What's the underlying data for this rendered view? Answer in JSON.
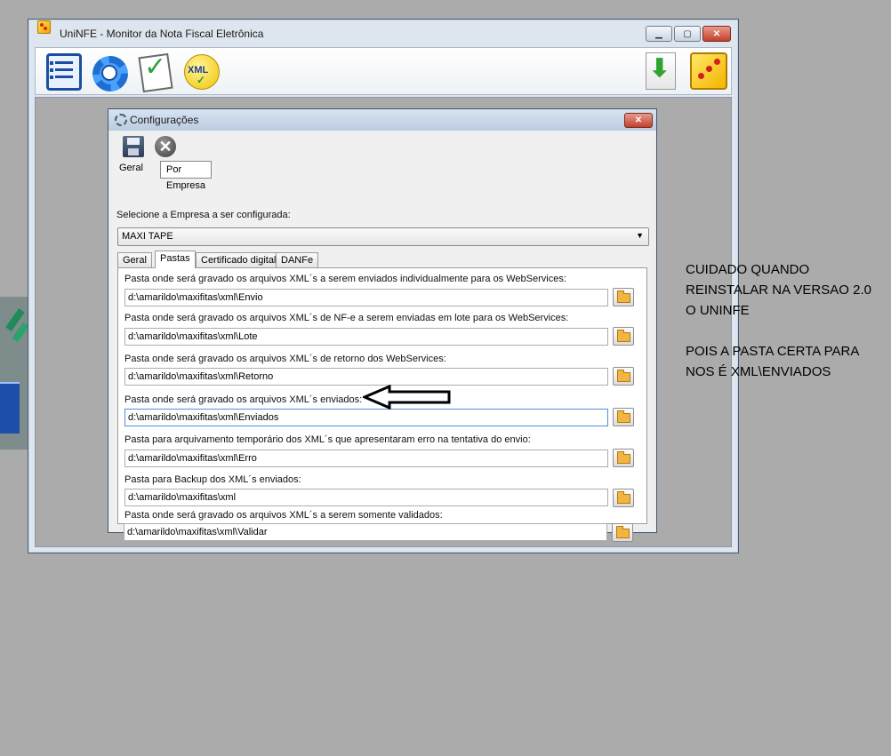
{
  "main_window": {
    "title": "UniNFE - Monitor da Nota Fiscal Eletrônica"
  },
  "icons": {
    "toolbar": [
      "forms-icon",
      "settings-gear-icon",
      "checklist-icon",
      "xml-icon",
      "download-icon",
      "app-logo-icon"
    ],
    "dialog": [
      "gear-icon",
      "save-icon",
      "cancel-icon",
      "folder-icon",
      "arrow-left-icon"
    ]
  },
  "config_dialog": {
    "title": "Configurações",
    "top_tabs": [
      "Geral",
      "Por Empresa"
    ],
    "company_label": "Selecione a Empresa a ser configurada:",
    "company_selected": "MAXI TAPE",
    "inner_tabs": [
      "Geral",
      "Pastas",
      "Certificado digital",
      "DANFe"
    ],
    "folders": [
      {
        "label": "Pasta onde será gravado os arquivos XML´s a serem enviados individualmente para os WebServices:",
        "value": "d:\\amarildo\\maxifitas\\xml\\Envio"
      },
      {
        "label": "Pasta onde será gravado os arquivos XML´s de NF-e a serem enviadas em lote para os WebServices:",
        "value": "d:\\amarildo\\maxifitas\\xml\\Lote"
      },
      {
        "label": "Pasta onde será gravado os arquivos XML´s de retorno dos WebServices:",
        "value": "d:\\amarildo\\maxifitas\\xml\\Retorno"
      },
      {
        "label": "Pasta onde será gravado os arquivos XML´s enviados:",
        "value": "d:\\amarildo\\maxifitas\\xml\\Enviados"
      },
      {
        "label": "Pasta para arquivamento temporário dos XML´s que apresentaram erro na tentativa do envio:",
        "value": "d:\\amarildo\\maxifitas\\xml\\Erro"
      },
      {
        "label": "Pasta para Backup dos XML´s enviados:",
        "value": "d:\\amarildo\\maxifitas\\xml"
      },
      {
        "label": "Pasta onde será gravado os arquivos XML´s a serem somente validados:",
        "value": "d:\\amarildo\\maxifitas\\xml\\Validar"
      }
    ]
  },
  "note_lines": [
    "CUIDADO QUANDO",
    "REINSTALAR NA VERSAO 2.0",
    "O UNINFE",
    "",
    "POIS A PASTA CERTA PARA",
    "NOS É XML\\ENVIADOS"
  ],
  "colors": {
    "desktop": "#ababab",
    "titlebar": "#dde6ef",
    "close_button": "#c2402a",
    "focus_border": "#4f90d6"
  }
}
